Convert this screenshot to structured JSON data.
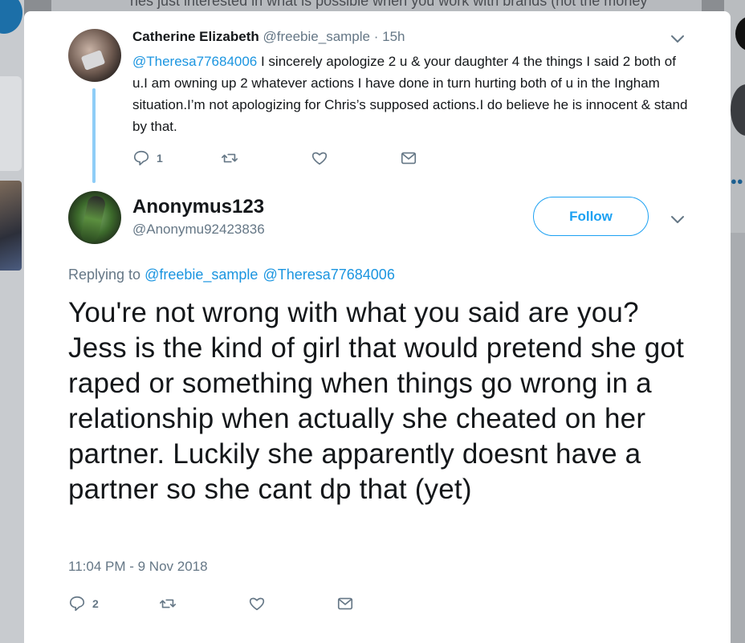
{
  "background": {
    "top_text": "hes just interested in what is possible when you work with brands (not the money"
  },
  "parent_tweet": {
    "name": "Catherine Elizabeth",
    "handle": "@freebie_sample",
    "time": "· 15h",
    "mention": "@Theresa77684006",
    "text": " I sincerely apologize 2 u & your daughter 4 the things I said 2 both of u.I am owning up 2 whatever actions I have done in turn hurting both of u in the Ingham situation.I’m not apologizing for Chris’s supposed actions.I do believe he is innocent & stand by that.",
    "reply_count": "1",
    "icons": [
      "reply-icon",
      "retweet-icon",
      "like-icon",
      "message-icon",
      "chevron-down-icon"
    ]
  },
  "main_tweet": {
    "name": "Anonymus123",
    "handle": "@Anonymu92423836",
    "follow_label": "Follow",
    "replying_label": "Replying to",
    "replying_mentions": [
      "@freebie_sample",
      "@Theresa77684006"
    ],
    "text": "You're not wrong with what you said are you? Jess is the kind of girl that would pretend she got raped or something when things go wrong in a relationship when actually she cheated on her partner. Luckily she apparently doesnt have a partner so she cant dp that (yet)",
    "timestamp": "11:04 PM - 9 Nov 2018",
    "reply_count": "2"
  },
  "colors": {
    "accent": "#1da1f2",
    "link": "#1b95e0",
    "thread_line": "#8ecdf7",
    "muted": "#657786",
    "text": "#14171a"
  }
}
